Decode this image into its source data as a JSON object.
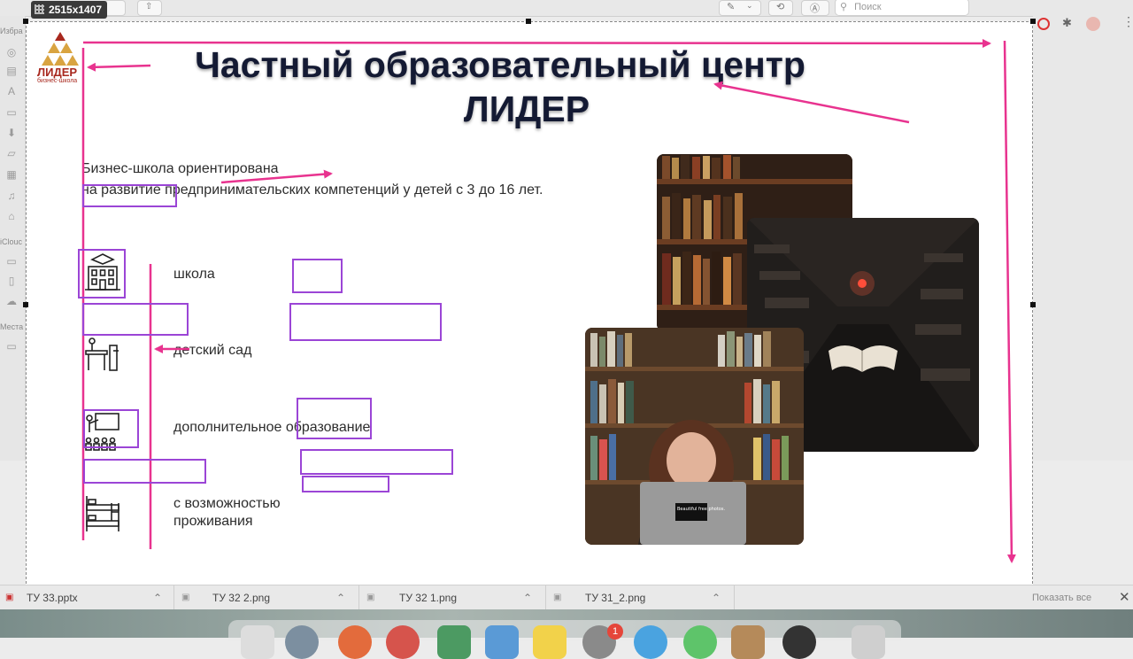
{
  "window": {
    "dimensions_badge": "2515x1407",
    "search_placeholder": "Поиск"
  },
  "sidebar": {
    "section_favorites": "Избра",
    "section_icloud": "iClouc",
    "section_places": "Места"
  },
  "slide": {
    "logo": {
      "name": "ЛИДЕР",
      "subtitle": "бизнес-школа"
    },
    "title_line1": "Частный образовательный центр",
    "title_line2": "ЛИДЕР",
    "description_line1": "Бизнес-школа ориентирована",
    "description_line2": "на развитие предпринимательских компетенций у детей с 3 до 16 лет.",
    "items": [
      {
        "label": "школа",
        "icon": "school-building-icon"
      },
      {
        "label": "детский сад",
        "icon": "kindergarten-desk-icon"
      },
      {
        "label": "дополнительное образование",
        "icon": "teacher-class-icon"
      },
      {
        "label_line1": "с возможностью",
        "label_line2": "проживания",
        "icon": "bunk-bed-icon"
      }
    ],
    "photo_laptop_sticker": "Beautiful free photos."
  },
  "tabs": [
    {
      "label": "ТУ 33.pptx"
    },
    {
      "label": "ТУ 32 2.png"
    },
    {
      "label": "ТУ 32 1.png"
    },
    {
      "label": "ТУ 31_2.png"
    }
  ],
  "show_all_label": "Показать все",
  "dock_badge": "1",
  "colors": {
    "annotation_arrow": "#e8338f",
    "annotation_box": "#9b45d6",
    "title_text": "#141a33",
    "logo_red": "#a8281e",
    "logo_gold": "#d9a441"
  }
}
